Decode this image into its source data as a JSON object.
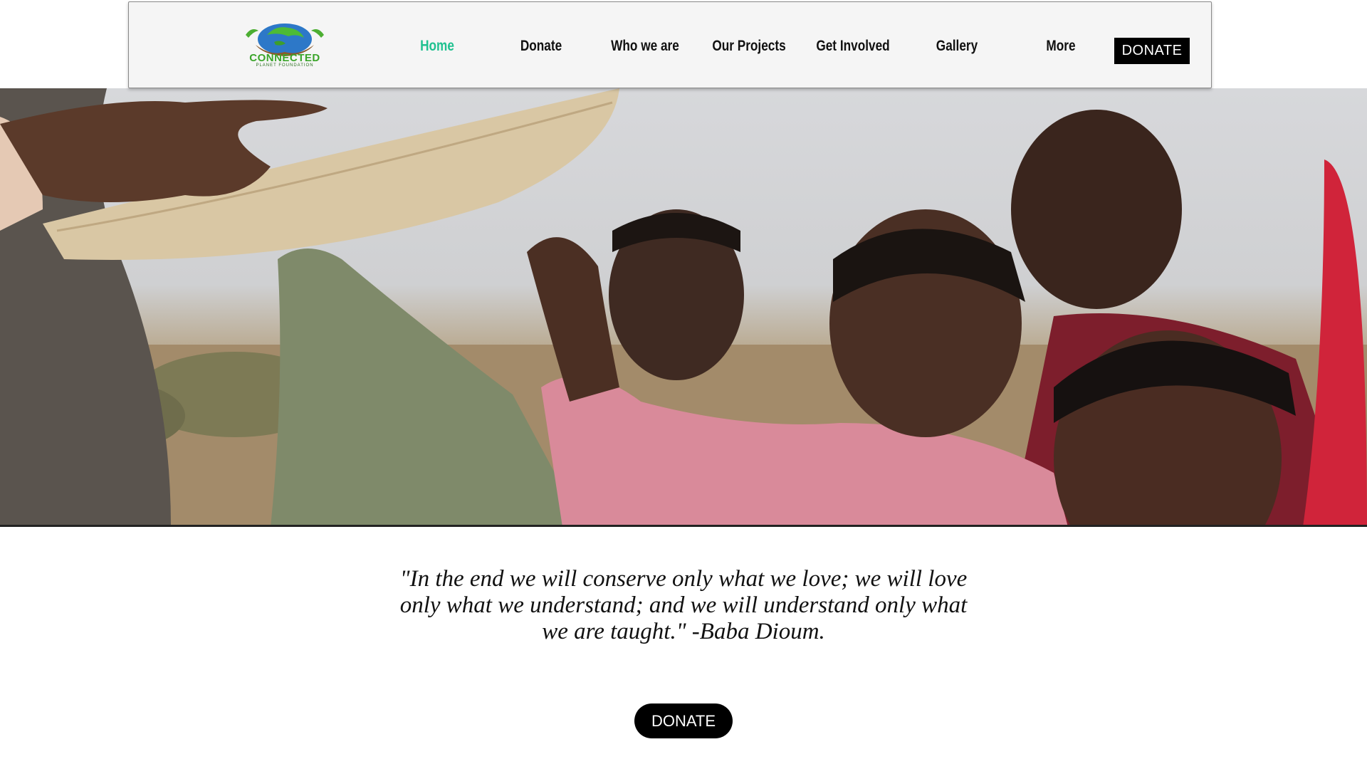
{
  "header": {
    "logo": {
      "title": "CONNECTED",
      "subtitle": "PLANET FOUNDATION",
      "icon": "earth-in-hands-icon"
    },
    "nav": [
      {
        "label": "Home",
        "active": true
      },
      {
        "label": "Donate",
        "active": false
      },
      {
        "label": "Who we are",
        "active": false
      },
      {
        "label": "Our Projects",
        "active": false
      },
      {
        "label": "Get Involved",
        "active": false
      },
      {
        "label": "Gallery",
        "active": false
      },
      {
        "label": "More",
        "active": false
      }
    ],
    "donate_button": "DONATE"
  },
  "hero": {
    "image": "children-holding-elephant-tusk-photo"
  },
  "quote": {
    "text": "\"In the end we will conserve only what we love; we will love only what we understand; and we will understand only what we are taught.\" -Baba Dioum."
  },
  "cta": {
    "donate_button": "DONATE"
  },
  "colors": {
    "accent": "#20c190",
    "button_bg": "#000000",
    "button_text": "#ffffff"
  }
}
